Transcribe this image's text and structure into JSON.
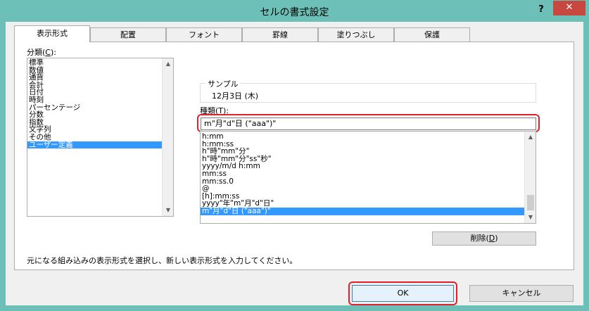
{
  "window": {
    "title": "セルの書式設定",
    "help": "?",
    "close": "✕"
  },
  "tabs": [
    {
      "label": "表示形式",
      "active": true
    },
    {
      "label": "配置"
    },
    {
      "label": "フォント"
    },
    {
      "label": "罫線"
    },
    {
      "label": "塗りつぶし"
    },
    {
      "label": "保護"
    }
  ],
  "category": {
    "label_prefix": "分類(",
    "label_key": "C",
    "label_suffix": "):",
    "items": [
      "標準",
      "数値",
      "通貨",
      "会計",
      "日付",
      "時刻",
      "パーセンテージ",
      "分数",
      "指数",
      "文字列",
      "その他",
      "ユーザー定義"
    ],
    "selected": "ユーザー定義"
  },
  "sample": {
    "label": "サンプル",
    "value": "12月3日 (木)"
  },
  "type": {
    "label_prefix": "種類(",
    "label_key": "T",
    "label_suffix": "):",
    "value": "m\"月\"d\"日 (\"aaa\")\"",
    "items": [
      "h:mm",
      "h:mm:ss",
      "h\"時\"mm\"分\"",
      "h\"時\"mm\"分\"ss\"秒\"",
      "yyyy/m/d h:mm",
      "mm:ss",
      "mm:ss.0",
      "@",
      "[h]:mm:ss",
      "yyyy\"年\"m\"月\"d\"日\"",
      "m\"月\"d\"日 (\"aaa\")\""
    ],
    "selected": "m\"月\"d\"日 (\"aaa\")\""
  },
  "delete_button": {
    "label": "削除(",
    "key": "D",
    "suffix": ")"
  },
  "description": "元になる組み込みの表示形式を選択し、新しい表示形式を入力してください。",
  "ok_button": "OK",
  "cancel_button": "キャンセル",
  "colors": {
    "title_bar": "#6cc0b8",
    "selection": "#3399ff",
    "highlight": "#e0202a",
    "close": "#c7483f"
  }
}
